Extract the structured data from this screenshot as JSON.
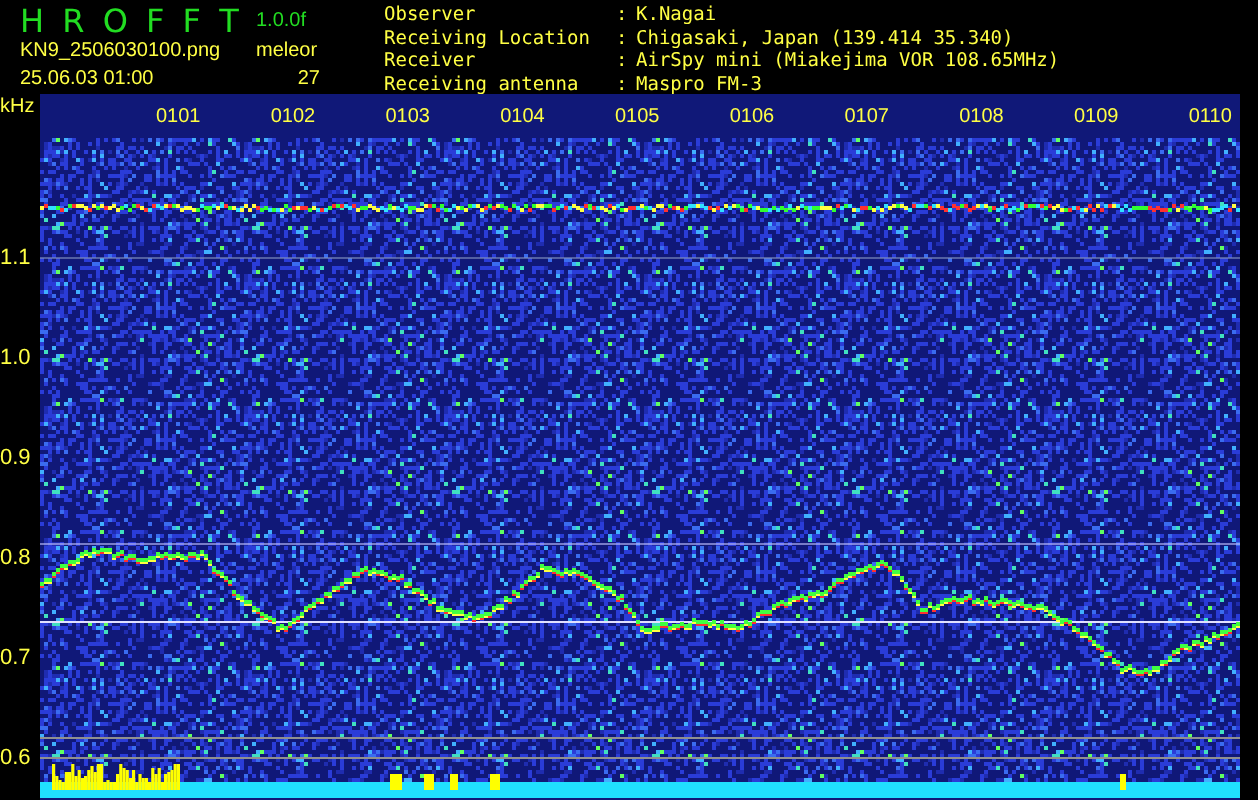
{
  "app": {
    "title": "H R O F F T",
    "version": "1.0.0f",
    "file": "KN9_2506030100.png",
    "timestamp": "25.06.03 01:00",
    "counter_label": "meleor",
    "counter_value": "27"
  },
  "station": [
    {
      "label": "Observer",
      "separator": ":",
      "value": "K.Nagai"
    },
    {
      "label": "Receiving Location",
      "separator": ":",
      "value": "Chigasaki, Japan (139.414 35.340)"
    },
    {
      "label": "Receiver",
      "separator": ":",
      "value": "AirSpy mini (Miakejima VOR 108.65MHz)"
    },
    {
      "label": "Receiving antenna",
      "separator": ":",
      "value": "Maspro FM-3"
    }
  ],
  "spectrogram": {
    "unit": "kHz",
    "frequency_labels": [
      "1.1",
      "1.0",
      "0.9",
      "0.8",
      "0.7",
      "0.6"
    ],
    "time_labels": [
      "0101",
      "0102",
      "0103",
      "0104",
      "0105",
      "0106",
      "0107",
      "0108",
      "0109",
      "0110"
    ]
  }
}
